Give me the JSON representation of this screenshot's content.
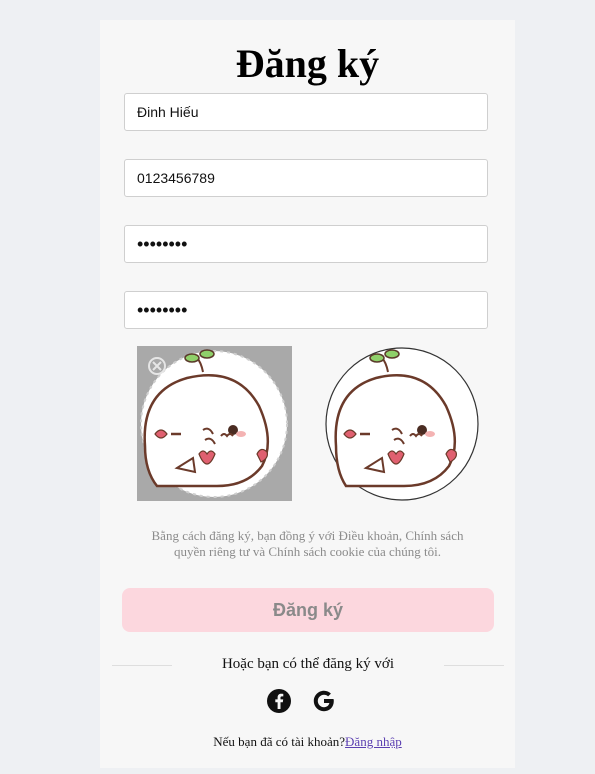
{
  "form": {
    "title": "Đăng ký",
    "name_value": "Đinh Hiếu",
    "phone_value": "0123456789",
    "password_value": "••••••••",
    "confirm_password_value": "••••••••"
  },
  "terms_line1": "Bằng cách đăng ký, bạn đồng ý với Điều khoản, Chính sách",
  "terms_line2": "quyền riêng tư và Chính sách cookie của chúng tôi.",
  "submit_label": "Đăng ký",
  "divider_text": "Hoặc bạn có thể đăng ký với",
  "social": {
    "facebook_icon": "facebook-icon",
    "google_icon": "google-icon"
  },
  "login_prompt": "Nếu bạn đã có tài khoản?",
  "login_link": "Đăng nhập",
  "colors": {
    "submit_bg": "#fcd7de",
    "link": "#5b3fb1",
    "page_bg": "#eef0f3"
  }
}
